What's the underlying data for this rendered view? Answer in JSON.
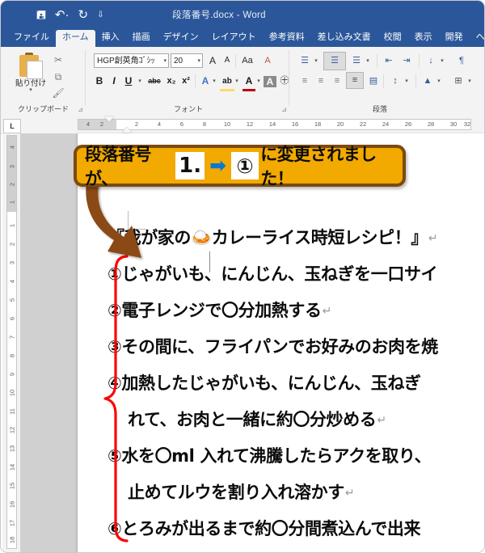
{
  "titlebar": {
    "document_title": "段落番号.docx  -  Word",
    "quick_access": [
      {
        "name": "save",
        "glyph": "὚B",
        "label": "上書き保存"
      },
      {
        "name": "undo",
        "glyph": "↶",
        "label": "元に戻す"
      },
      {
        "name": "redo",
        "glyph": "↻",
        "label": "繰り返し"
      },
      {
        "name": "customize",
        "glyph": "⯆",
        "label": "クイック アクセス ツール バーのユーザー設定"
      }
    ]
  },
  "tabs": [
    {
      "label": "ファイル",
      "active": false
    },
    {
      "label": "ホーム",
      "active": true
    },
    {
      "label": "挿入",
      "active": false
    },
    {
      "label": "描画",
      "active": false
    },
    {
      "label": "デザイン",
      "active": false
    },
    {
      "label": "レイアウト",
      "active": false
    },
    {
      "label": "参考資料",
      "active": false
    },
    {
      "label": "差し込み文書",
      "active": false
    },
    {
      "label": "校閲",
      "active": false
    },
    {
      "label": "表示",
      "active": false
    },
    {
      "label": "開発",
      "active": false
    },
    {
      "label": "ヘル",
      "active": false
    }
  ],
  "ribbon": {
    "clipboard": {
      "group_label": "クリップボード",
      "paste_label": "貼り付け",
      "paste_caret": "▾",
      "cut_icon": "✂",
      "copy_icon": "⧉",
      "format_painter_icon": "🖌",
      "dialog_launcher": "⊿"
    },
    "font": {
      "group_label": "フォント",
      "font_name": "HGP創英角ｺﾞｼｯ",
      "font_size": "20",
      "caret": "▾",
      "grow_font": "A",
      "shrink_font": "A",
      "change_case": "Aa",
      "clear_formatting": "A",
      "phonetic_guide": "あ",
      "character_border": "A",
      "bold": "B",
      "italic": "I",
      "underline": "U",
      "strikethrough": "abc",
      "subscript": "x₂",
      "superscript": "x²",
      "text_effects": "A",
      "highlight": "ab",
      "font_color": "A",
      "shading": "A",
      "enclose_character": "㊉",
      "dialog_launcher": "⊿"
    },
    "paragraph": {
      "group_label": "段落",
      "bullets": "☰",
      "numbering": "☰",
      "multilevel_list": "☰",
      "decrease_indent": "⇤",
      "increase_indent": "⇥",
      "sort": "↓",
      "show_marks": "¶",
      "align_left": "≡",
      "align_center": "≡",
      "align_right": "≡",
      "justify": "≡",
      "distributed": "▤",
      "line_spacing": "↕",
      "shading": "▲",
      "borders": "⊞",
      "caret": "▾"
    }
  },
  "rulers": {
    "tab_stop_marker": "L",
    "horizontal_numbers": [
      "4",
      "2",
      "2",
      "4",
      "6",
      "8",
      "10",
      "12",
      "14",
      "16",
      "18",
      "20",
      "22",
      "24",
      "26",
      "28",
      "30",
      "32"
    ],
    "vertical_margin_numbers": [
      "4",
      "3",
      "2",
      "1"
    ],
    "vertical_numbers": [
      "1",
      "2",
      "3",
      "4",
      "5",
      "6",
      "7",
      "8",
      "9",
      "10",
      "11",
      "12",
      "13",
      "14",
      "15",
      "16",
      "17",
      "18"
    ]
  },
  "callout": {
    "text_before": "段落番号が、",
    "old_value": "1.",
    "arrow": "➡",
    "new_value": "①",
    "text_after": "に変更されました！",
    "fill_color": "#F2A900",
    "border_color": "#7B4A10",
    "arrow_color": "#0B78D0"
  },
  "annotations": {
    "brown_arrow_color": "#8B4A12",
    "red_brace_color": "#FF0000"
  },
  "document": {
    "lines": [
      {
        "id": "title",
        "text": "『我が家の🍛カレーライス時短レシピ！』",
        "mark": "↵",
        "indent": false
      },
      {
        "id": "item1",
        "text": "①じゃがいも、にんじん、玉ねぎを一口サイ",
        "mark": "",
        "indent": false
      },
      {
        "id": "item2",
        "text": "②電子レンジで〇分加熱する",
        "mark": "↵",
        "indent": false
      },
      {
        "id": "item3",
        "text": "③その間に、フライパンでお好みのお肉を焼",
        "mark": "",
        "indent": false
      },
      {
        "id": "item4",
        "text": "④加熱したじゃがいも、にんじん、玉ねぎ",
        "mark": "",
        "indent": false
      },
      {
        "id": "item4b",
        "text": "れて、お肉と一緒に約〇分炒める",
        "mark": "↵",
        "indent": true
      },
      {
        "id": "item5",
        "text": "⑤水を〇ml 入れて沸騰したらアクを取り、",
        "mark": "",
        "indent": false
      },
      {
        "id": "item5b",
        "text": "止めてルウを割り入れ溶かす",
        "mark": "↵",
        "indent": true
      },
      {
        "id": "item6",
        "text": "⑥とろみが出るまで約〇分間煮込んで出来",
        "mark": "",
        "indent": false
      }
    ]
  }
}
